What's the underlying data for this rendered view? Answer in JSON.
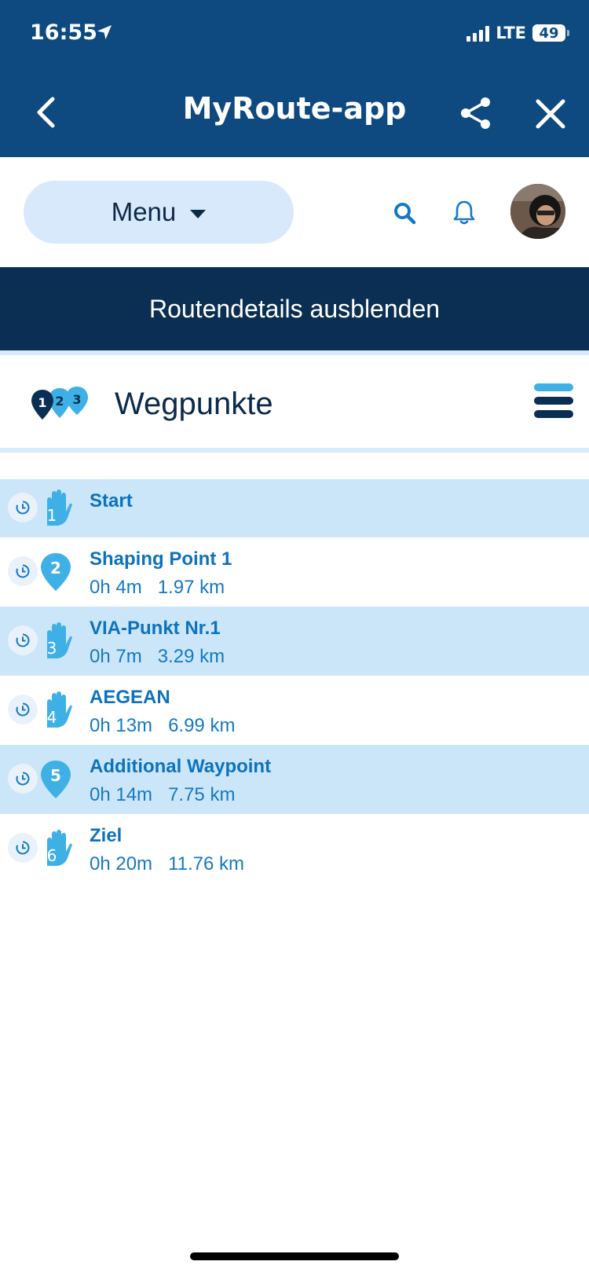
{
  "status": {
    "time": "16:55",
    "network": "LTE",
    "battery": "49"
  },
  "header": {
    "title": "MyRoute-app"
  },
  "toolbar": {
    "menu_label": "Menu"
  },
  "banner": {
    "label": "Routendetails ausblenden"
  },
  "section": {
    "title": "Wegpunkte",
    "logo_numbers": [
      "1",
      "2",
      "3"
    ]
  },
  "waypoints": [
    {
      "num": "1",
      "type": "hand",
      "name": "Start",
      "time": "",
      "distance": ""
    },
    {
      "num": "2",
      "type": "pin",
      "name": "Shaping Point 1",
      "time": "0h 4m",
      "distance": "1.97 km"
    },
    {
      "num": "3",
      "type": "hand",
      "name": "VIA-Punkt Nr.1",
      "time": "0h 7m",
      "distance": "3.29 km"
    },
    {
      "num": "4",
      "type": "hand",
      "name": "AEGEAN",
      "time": "0h 13m",
      "distance": "6.99 km"
    },
    {
      "num": "5",
      "type": "pin",
      "name": "Additional Waypoint",
      "time": "0h 14m",
      "distance": "7.75 km"
    },
    {
      "num": "6",
      "type": "hand",
      "name": "Ziel",
      "time": "0h 20m",
      "distance": "11.76 km"
    }
  ],
  "colors": {
    "header_bg": "#0e4a80",
    "banner_bg": "#0b2f52",
    "row_alt_bg": "#cbe6f8",
    "accent": "#0d72bd",
    "icon_blue": "#3fb0e6"
  }
}
